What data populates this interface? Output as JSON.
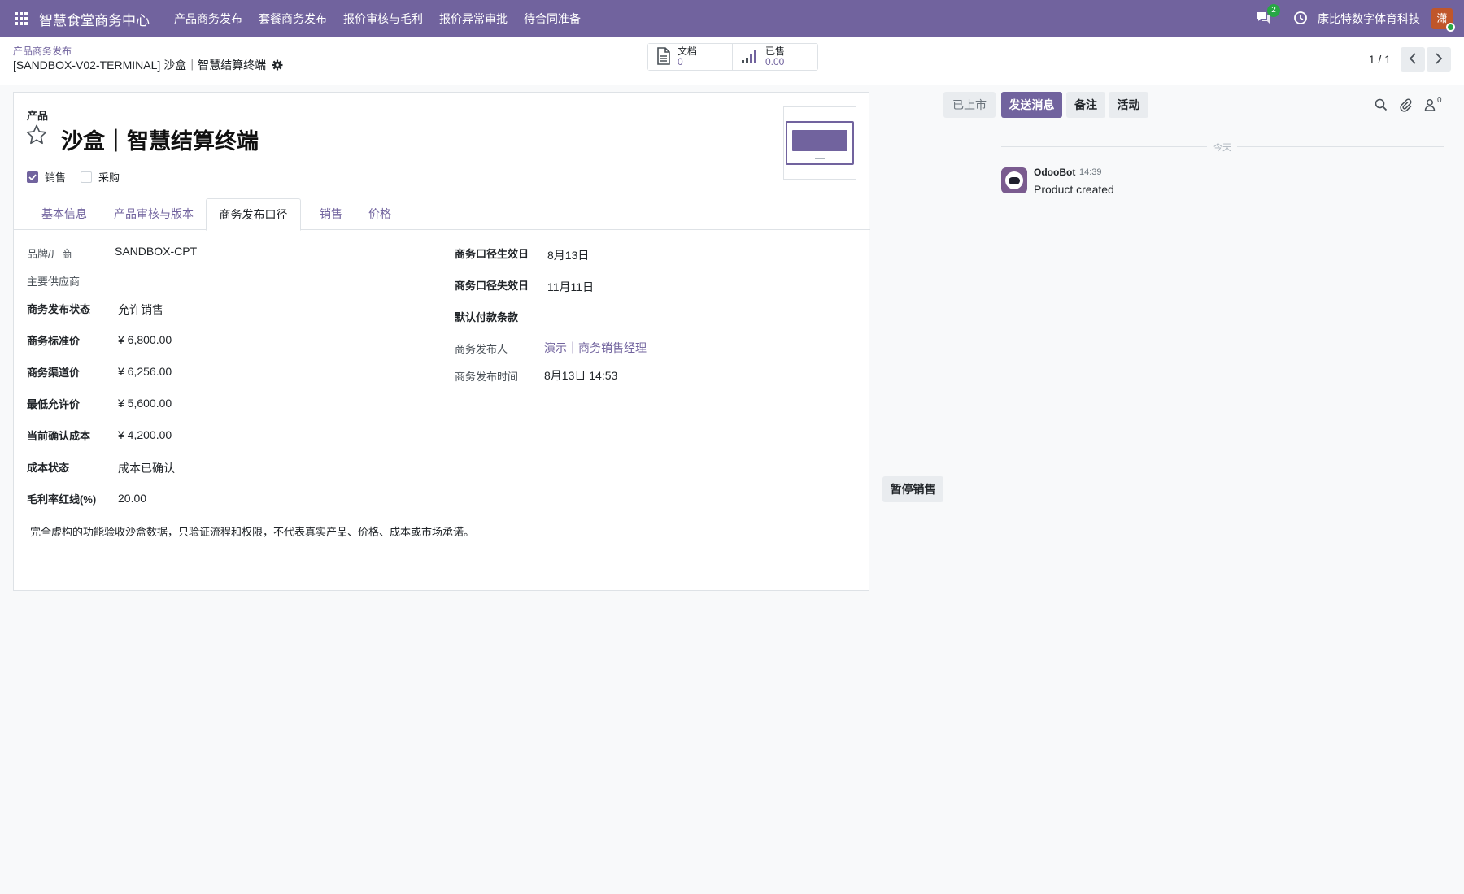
{
  "navbar": {
    "brand": "智慧食堂商务中心",
    "menu": [
      "产品商务发布",
      "套餐商务发布",
      "报价审核与毛利",
      "报价异常审批",
      "待合同准备"
    ],
    "chat_badge": "2",
    "company": "康比特数字体育科技",
    "avatar_initial": "潇"
  },
  "control": {
    "breadcrumb": "产品商务发布",
    "record_name": "[SANDBOX-V02-TERMINAL] 沙盒｜智慧结算终端",
    "stat_docs": {
      "label": "文档",
      "value": "0"
    },
    "stat_sold": {
      "label": "已售",
      "value": "0.00"
    },
    "pager": "1 / 1"
  },
  "form": {
    "product_type": "产品",
    "title": "沙盒｜智慧结算终端",
    "check_sale": "销售",
    "check_purchase": "采购",
    "tabs": [
      "基本信息",
      "产品审核与版本",
      "商务发布口径",
      "销售",
      "价格"
    ],
    "left_fields": [
      {
        "label": "品牌/厂商",
        "value": "SANDBOX-CPT"
      },
      {
        "label": "主要供应商",
        "value": ""
      },
      {
        "label": "商务发布状态",
        "value": "允许销售"
      },
      {
        "label": "商务标准价",
        "value": "¥ 6,800.00"
      },
      {
        "label": "商务渠道价",
        "value": "¥ 6,256.00"
      },
      {
        "label": "最低允许价",
        "value": "¥ 5,600.00"
      },
      {
        "label": "当前确认成本",
        "value": "¥ 4,200.00"
      },
      {
        "label": "成本状态",
        "value": "成本已确认"
      },
      {
        "label": "毛利率红线(%)",
        "value": "20.00"
      }
    ],
    "right_fields": [
      {
        "label": "商务口径生效日",
        "value": "8月13日"
      },
      {
        "label": "商务口径失效日",
        "value": "11月11日"
      },
      {
        "label": "默认付款条款",
        "value": ""
      },
      {
        "label": "商务发布人",
        "value": "演示｜商务销售经理"
      },
      {
        "label": "商务发布时间",
        "value": "8月13日 14:53"
      }
    ],
    "note": "完全虚构的功能验收沙盒数据，只验证流程和权限，不代表真实产品、价格、成本或市场承诺。"
  },
  "status": {
    "listed": "已上市",
    "pause_sale": "暂停销售"
  },
  "chatter": {
    "send_message": "发送消息",
    "log_note": "备注",
    "activity": "活动",
    "follower_count": "0",
    "today": "今天",
    "message": {
      "author": "OdooBot",
      "time": "14:39",
      "body": "Product created"
    }
  },
  "colors": {
    "brand": "#71639e",
    "badge": "#28a745",
    "avatar": "#c0562a"
  }
}
